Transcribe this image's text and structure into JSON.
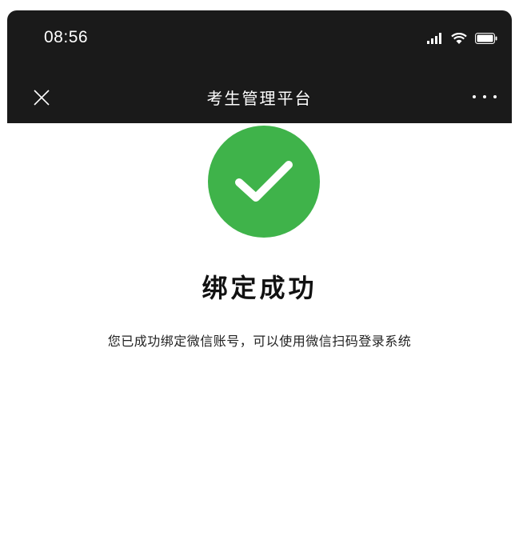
{
  "status_bar": {
    "time": "08:56",
    "icons": [
      "signal-icon",
      "wifi-icon",
      "battery-icon"
    ]
  },
  "nav": {
    "title": "考生管理平台",
    "close_icon": "close-icon",
    "more_icon": "more-icon"
  },
  "result": {
    "icon": "checkmark-icon",
    "title": "绑定成功",
    "description": "您已成功绑定微信账号，可以使用微信扫码登录系统"
  },
  "colors": {
    "header_bg": "#1a1a1a",
    "success_green": "#3fb34a",
    "page_bg": "#ffffff"
  }
}
